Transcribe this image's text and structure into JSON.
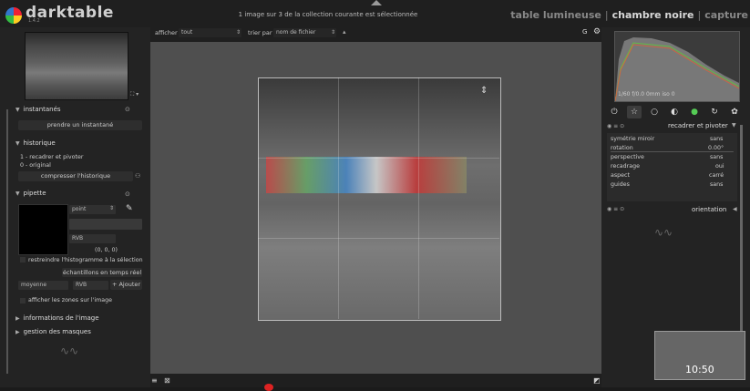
{
  "app": {
    "name": "darktable",
    "version": "1.4.2",
    "status_text": "1 image sur 3 de la collection courante est sélectionnée",
    "views": {
      "lighttable": "table lumineuse",
      "darkroom": "chambre noire",
      "capture": "capture",
      "separator": "|"
    }
  },
  "left_panel": {
    "snapshots": {
      "title": "instantanés",
      "take_button": "prendre un instantané"
    },
    "history": {
      "title": "historique",
      "items": [
        "1 - recadrer et pivoter",
        "0 - original"
      ],
      "compress_button": "compresser l'historique"
    },
    "picker": {
      "title": "pipette",
      "mode_value": "point",
      "color_space": "RVB",
      "readout": "(0, 0, 0)",
      "restrict_label": "restreindre l'histogramme à la sélection",
      "live_samples_button": "échantillons en temps réel",
      "stat_value": "moyenne",
      "stat_space": "RVB",
      "add_button": "Ajouter",
      "show_zones_label": "afficher les zones sur l'image"
    },
    "image_info": {
      "title": "informations de l'image"
    },
    "masks": {
      "title": "gestion des masques"
    }
  },
  "center": {
    "show_label": "afficher",
    "show_value": "tout",
    "sort_label": "trier par",
    "sort_value": "nom de fichier",
    "g_label": "G"
  },
  "right_panel": {
    "histogram_readout": "1/60 f/0.0 0mm iso 0",
    "module_title": "recadrer et pivoter",
    "params": [
      {
        "label": "symétrie miroir",
        "value": "sans"
      },
      {
        "label": "rotation",
        "value": "0.00°"
      },
      {
        "label": "perspective",
        "value": "sans"
      },
      {
        "label": "recadrage",
        "value": "oui"
      },
      {
        "label": "aspect",
        "value": "carré"
      },
      {
        "label": "guides",
        "value": "sans"
      }
    ],
    "orientation_title": "orientation"
  },
  "overlay": {
    "clock": "10:50"
  },
  "colors": {
    "accent": "#d22",
    "background": "#1b1b1b",
    "panel": "#232323",
    "canvas": "#4f4f4f"
  }
}
